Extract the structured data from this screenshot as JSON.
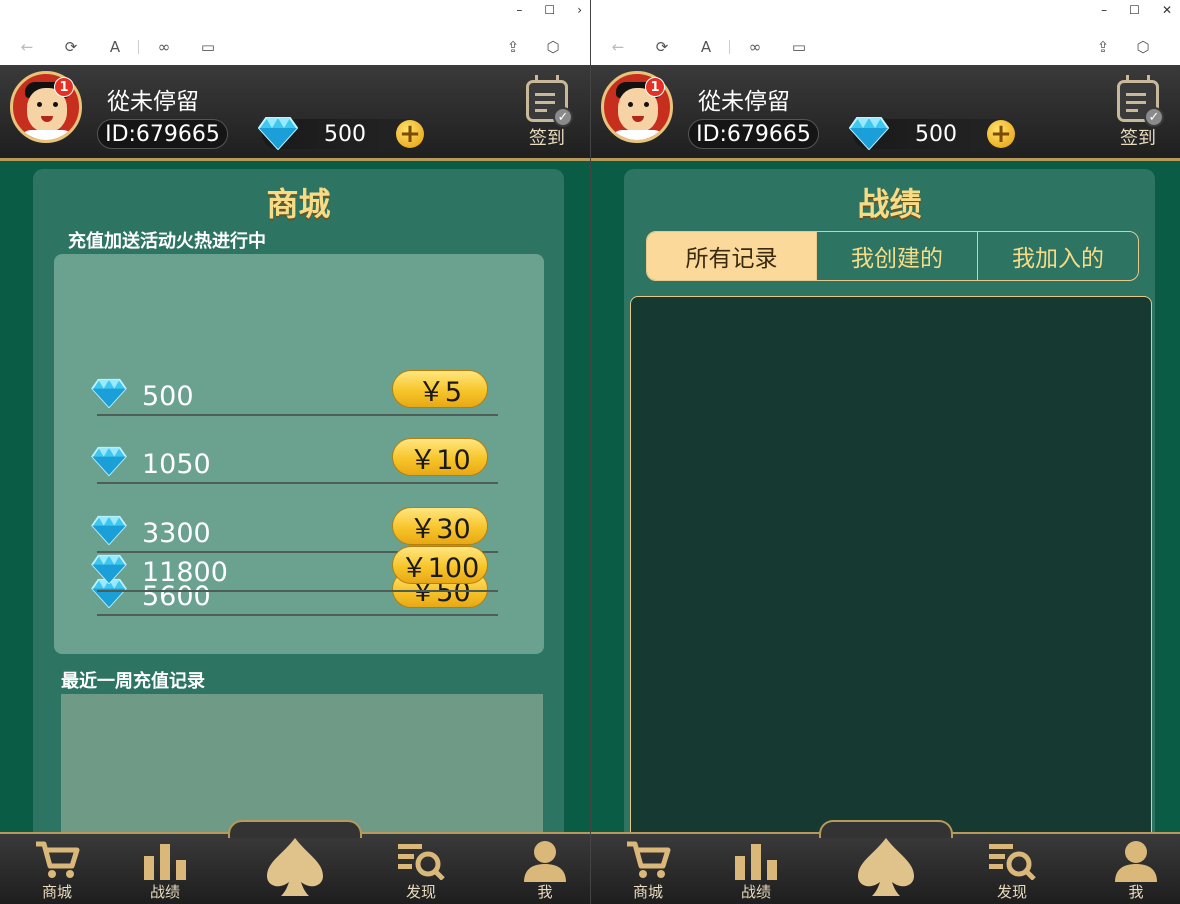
{
  "windows": [
    {
      "id": "w1",
      "user": {
        "name": "從未停留",
        "id_label": "ID:679665",
        "gems": "500",
        "badge": "1"
      },
      "signin_label": "签到",
      "shop": {
        "title": "商城",
        "promo": "充值加送活动火热进行中",
        "items": [
          {
            "amount": "500",
            "price": "￥5"
          },
          {
            "amount": "1050",
            "price": "￥10"
          },
          {
            "amount": "3300",
            "price": "￥30"
          },
          {
            "amount": "5600",
            "price": "￥50"
          },
          {
            "amount": "11800",
            "price": "￥100"
          }
        ],
        "records_label": "最近一周充值记录"
      },
      "nav": {
        "shop": "商城",
        "record": "战绩",
        "discover": "发现",
        "me": "我"
      }
    },
    {
      "id": "w2",
      "user": {
        "name": "從未停留",
        "id_label": "ID:679665",
        "gems": "500",
        "badge": "1"
      },
      "signin_label": "签到",
      "records": {
        "title": "战绩",
        "tabs": [
          "所有记录",
          "我创建的",
          "我加入的"
        ]
      },
      "nav": {
        "shop": "商城",
        "record": "战绩",
        "discover": "发现",
        "me": "我"
      }
    }
  ],
  "colors": {
    "accent_gold": "#f7dc87",
    "bg_green": "#0b5c45",
    "bar_dark": "#2a2a2a"
  },
  "icons": [
    "back-icon",
    "refresh-icon",
    "text-icon",
    "link-icon",
    "window-icon",
    "share-icon",
    "cube-icon",
    "diamond-icon",
    "plus-icon",
    "calendar-icon",
    "cart-icon",
    "bar-chart-icon",
    "spade-icon",
    "search-list-icon",
    "person-icon"
  ]
}
